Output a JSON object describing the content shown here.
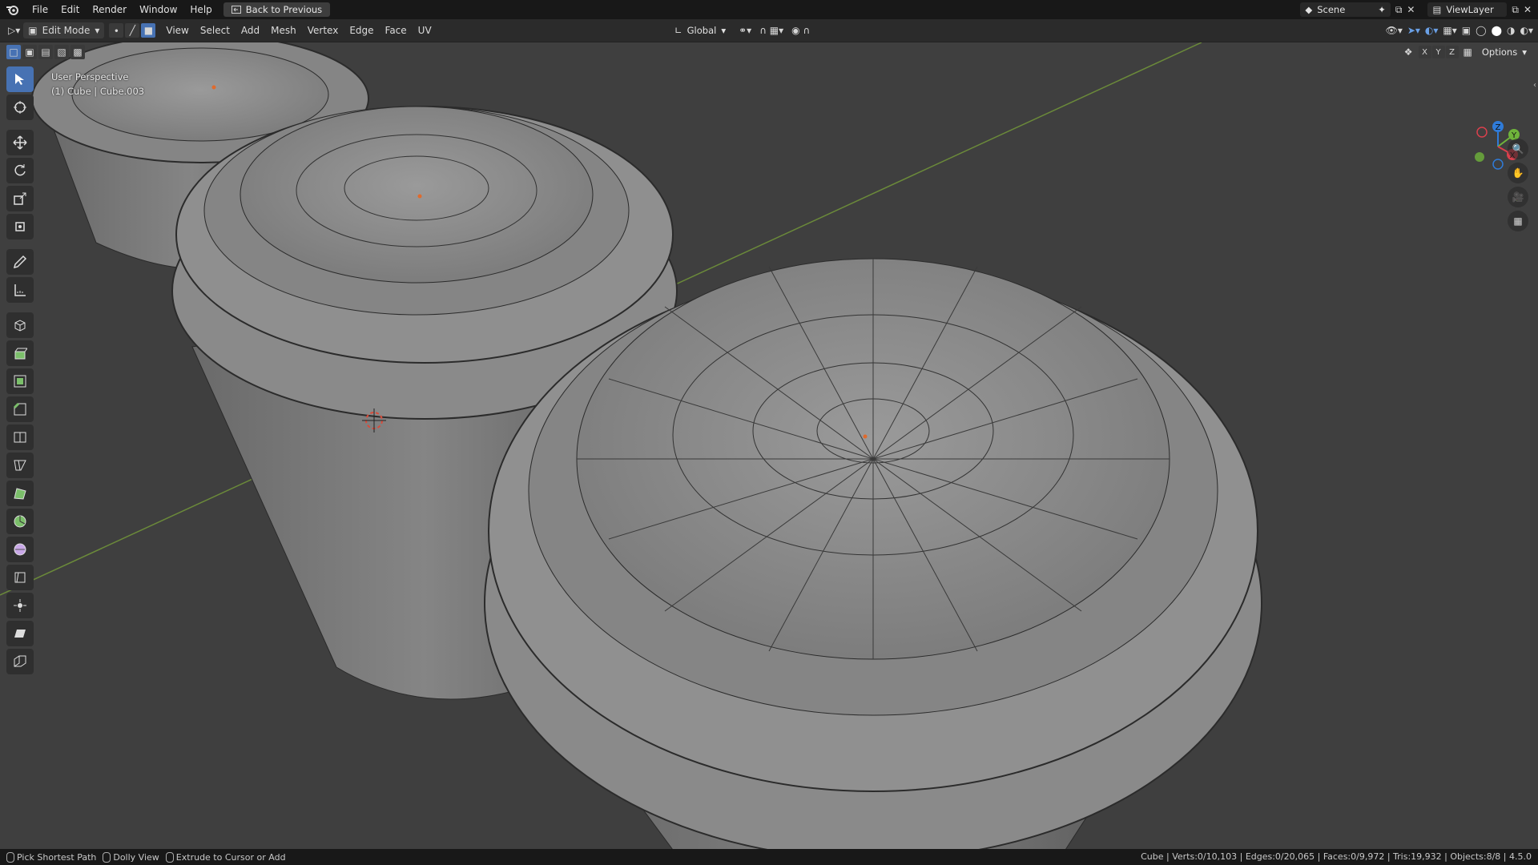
{
  "menu": {
    "file": "File",
    "edit": "Edit",
    "render": "Render",
    "window": "Window",
    "help": "Help",
    "back_to_previous": "Back to Previous"
  },
  "top_right": {
    "scene": "Scene",
    "view_layer": "ViewLayer"
  },
  "header": {
    "mode": "Edit Mode",
    "menus": [
      "View",
      "Select",
      "Add",
      "Mesh",
      "Vertex",
      "Edge",
      "Face",
      "UV"
    ],
    "orientation": "Global",
    "options": "Options",
    "axes": [
      "X",
      "Y",
      "Z"
    ]
  },
  "viewport": {
    "perspective": "User Perspective",
    "object": "(1) Cube | Cube.003"
  },
  "gizmo": {
    "x": "X",
    "y": "Y",
    "z": "Z"
  },
  "tools": [
    "select-box-icon",
    "cursor-icon",
    "move-icon",
    "rotate-icon",
    "scale-icon",
    "transform-icon",
    "annotate-icon",
    "measure-icon",
    "add-cube-icon",
    "extrude-region-icon",
    "inset-faces-icon",
    "bevel-icon",
    "loop-cut-icon",
    "knife-icon",
    "poly-build-icon",
    "spin-icon",
    "smooth-icon",
    "edge-slide-icon",
    "shrink-fatten-icon",
    "shear-icon",
    "rip-region-icon"
  ],
  "status": {
    "hint1": "Pick Shortest Path",
    "hint2": "Dolly View",
    "hint3": "Extrude to Cursor or Add",
    "stats": "Cube | Verts:0/10,103 | Edges:0/20,065 | Faces:0/9,972 | Tris:19,932 | Objects:8/8 | 4.5.0"
  },
  "colors": {
    "select_active": "#4772b3",
    "viewport_bg": "#3f3f3f",
    "mesh": "#8f8f8f"
  }
}
